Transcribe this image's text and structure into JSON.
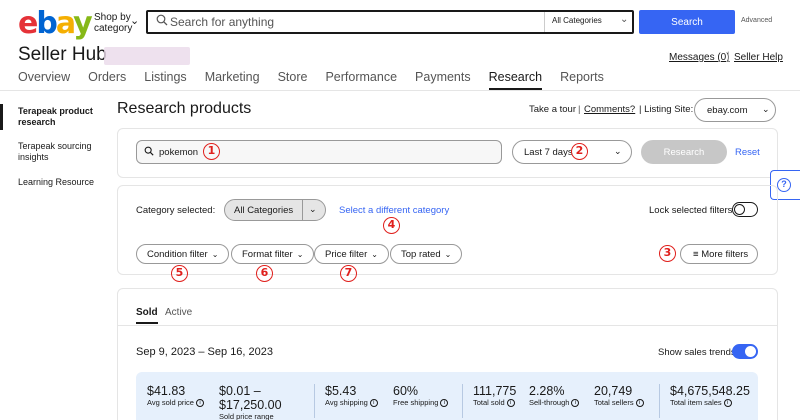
{
  "header": {
    "logo": {
      "e": "e",
      "b": "b",
      "a": "a",
      "y": "y"
    },
    "shop_by_line1": "Shop by",
    "shop_by_line2": "category",
    "search_placeholder": "Search for anything",
    "category_select": "All Categories",
    "search_button": "Search",
    "advanced": "Advanced"
  },
  "hub": {
    "title": "Seller Hub",
    "messages": "Messages (0)",
    "separator": "|",
    "seller_help": "Seller Help"
  },
  "nav": {
    "tabs": [
      "Overview",
      "Orders",
      "Listings",
      "Marketing",
      "Store",
      "Performance",
      "Payments",
      "Research",
      "Reports"
    ],
    "active": "Research"
  },
  "sidebar": {
    "items": [
      {
        "label": "Terapeak product research",
        "active": true
      },
      {
        "label": "Terapeak sourcing insights",
        "active": false
      },
      {
        "label": "Learning Resource",
        "active": false
      }
    ]
  },
  "main": {
    "title": "Research products",
    "take_tour": "Take a tour",
    "separator": "|",
    "comments": "Comments?",
    "listing_site_label": "| Listing Site:",
    "listing_site_value": "ebay.com",
    "keyword": "pokemon",
    "period": "Last 7 days",
    "research_button": "Research",
    "reset": "Reset",
    "help_symbol": "?"
  },
  "filters": {
    "category_label": "Category selected:",
    "category_value": "All Categories",
    "different_category": "Select a different category",
    "lock_label": "Lock selected filters",
    "chips": [
      "Condition filter",
      "Format filter",
      "Price filter",
      "Top rated"
    ],
    "more_filters": "More filters"
  },
  "badges": [
    "1",
    "2",
    "3",
    "4",
    "5",
    "6",
    "7"
  ],
  "results": {
    "tabs": [
      "Sold",
      "Active"
    ],
    "active_tab": "Sold",
    "date_range": "Sep 9, 2023 – Sep 16, 2023",
    "sales_trends_label": "Show sales trends",
    "sales_trends_on": true,
    "stats": [
      {
        "value": "$41.83",
        "label": "Avg sold price"
      },
      {
        "value": "$0.01 –",
        "value2": "$17,250.00",
        "label": "Sold price range"
      },
      {
        "value": "$5.43",
        "label": "Avg shipping"
      },
      {
        "value": "60%",
        "label": "Free shipping"
      },
      {
        "value": "111,775",
        "label": "Total sold"
      },
      {
        "value": "2.28%",
        "label": "Sell-through"
      },
      {
        "value": "20,749",
        "label": "Total sellers"
      },
      {
        "value": "$4,675,548.25",
        "label": "Total item sales"
      }
    ]
  },
  "colors": {
    "accent": "#3665f3",
    "badge": "#e0201d",
    "stats_bg": "#e6f0fc"
  }
}
